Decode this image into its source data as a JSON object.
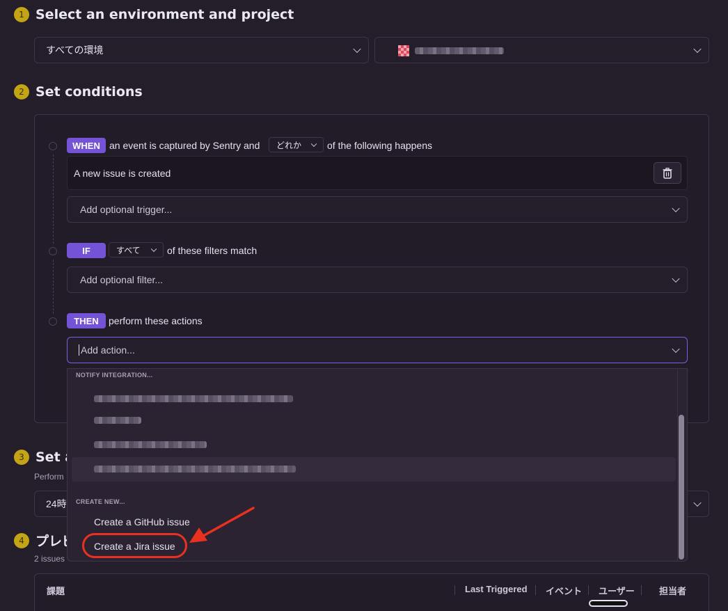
{
  "steps": [
    {
      "num": "1",
      "title": "Select an environment and project"
    },
    {
      "num": "2",
      "title": "Set conditions"
    },
    {
      "num": "3",
      "title": "Set a"
    },
    {
      "num": "4",
      "title": "プレビ"
    }
  ],
  "env_select": {
    "value": "すべての環境"
  },
  "project_select": {
    "value": ""
  },
  "when": {
    "tag": "WHEN",
    "text1": "an event is captured by Sentry and",
    "match": "どれか",
    "text2": "of the following happens"
  },
  "trigger": {
    "label": "A new issue is created",
    "add_placeholder": "Add optional trigger..."
  },
  "if": {
    "tag": "IF",
    "match": "すべて",
    "text": "of these filters match",
    "add_placeholder": "Add optional filter..."
  },
  "then": {
    "tag": "THEN",
    "text": "perform these actions",
    "add_placeholder": "Add action..."
  },
  "dropdown": {
    "notify_header": "NOTIFY INTEGRATION...",
    "create_header": "CREATE NEW...",
    "create_items": [
      "Create a GitHub issue",
      "Create a Jira issue"
    ]
  },
  "step3": {
    "subtitle": "Perform",
    "select_value": "24時"
  },
  "step4": {
    "subtitle": "2 issues"
  },
  "table": {
    "col_issue": "課題",
    "col_last": "Last Triggered",
    "col_event": "イベント",
    "col_user": "ユーザー",
    "col_assignee": "担当者"
  },
  "colors": {
    "accent": "#7553d6",
    "step_badge": "#c3a416",
    "highlight": "#e8321f"
  }
}
